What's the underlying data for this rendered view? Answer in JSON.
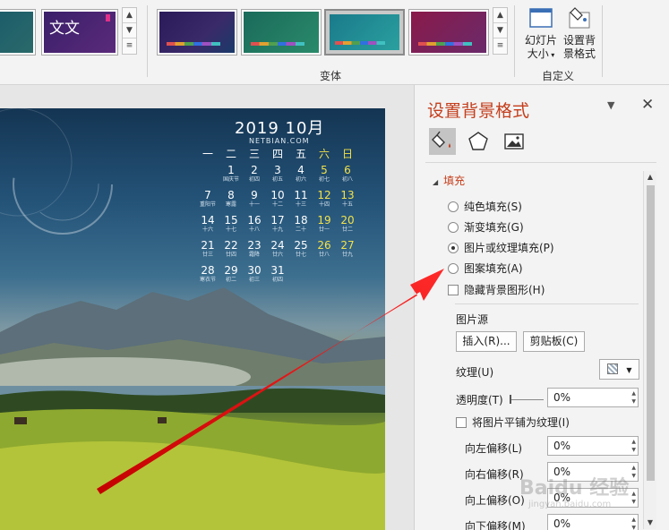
{
  "ribbon": {
    "variant_group_label": "变体",
    "custom_group_label": "自定义",
    "theme_thumb_text": "文文",
    "slide_size_label_1": "幻灯片",
    "slide_size_label_2": "大小",
    "format_bg_label_1": "设置背",
    "format_bg_label_2": "景格式",
    "colors": {
      "variant1": "#2a2a5a",
      "variant2": "#1f6a6a",
      "variant3": "#1c7a8a",
      "variant4": "#7a2a5a"
    }
  },
  "slide": {
    "calendar_title": "2019 10月",
    "calendar_site": "NETBIAN.COM",
    "weekdays": [
      "一",
      "二",
      "三",
      "四",
      "五",
      "六",
      "日"
    ],
    "weeks": [
      [
        [
          "",
          ""
        ],
        [
          "1",
          "国庆节"
        ],
        [
          "2",
          "初四"
        ],
        [
          "3",
          "初五"
        ],
        [
          "4",
          "初六"
        ],
        [
          "5",
          "初七"
        ],
        [
          "6",
          "初八"
        ]
      ],
      [
        [
          "7",
          "重阳节"
        ],
        [
          "8",
          "寒露"
        ],
        [
          "9",
          "十一"
        ],
        [
          "10",
          "十二"
        ],
        [
          "11",
          "十三"
        ],
        [
          "12",
          "十四"
        ],
        [
          "13",
          "十五"
        ]
      ],
      [
        [
          "14",
          "十六"
        ],
        [
          "15",
          "十七"
        ],
        [
          "16",
          "十八"
        ],
        [
          "17",
          "十九"
        ],
        [
          "18",
          "二十"
        ],
        [
          "19",
          "廿一"
        ],
        [
          "20",
          "廿二"
        ]
      ],
      [
        [
          "21",
          "廿三"
        ],
        [
          "22",
          "廿四"
        ],
        [
          "23",
          "霜降"
        ],
        [
          "24",
          "廿六"
        ],
        [
          "25",
          "廿七"
        ],
        [
          "26",
          "廿八"
        ],
        [
          "27",
          "廿九"
        ]
      ],
      [
        [
          "28",
          "寒衣节"
        ],
        [
          "29",
          "初二"
        ],
        [
          "30",
          "初三"
        ],
        [
          "31",
          "初四"
        ],
        [
          "",
          ""
        ],
        [
          "",
          ""
        ],
        [
          "",
          ""
        ]
      ]
    ]
  },
  "pane": {
    "title": "设置背景格式",
    "menu_glyph": "▼",
    "close_glyph": "✕",
    "section_fill": "填充",
    "fill_options": [
      {
        "label": "纯色填充(S)",
        "selected": false
      },
      {
        "label": "渐变填充(G)",
        "selected": false
      },
      {
        "label": "图片或纹理填充(P)",
        "selected": true
      },
      {
        "label": "图案填充(A)",
        "selected": false
      }
    ],
    "hide_bg_graphics": "隐藏背景图形(H)",
    "picture_source_label": "图片源",
    "insert_button": "插入(R)...",
    "clipboard_button": "剪贴板(C)",
    "texture_label": "纹理(U)",
    "transparency_label": "透明度(T)",
    "transparency_value": "0%",
    "tile_label": "将图片平铺为纹理(I)",
    "offset_left_label": "向左偏移(L)",
    "offset_left_value": "0%",
    "offset_right_label": "向右偏移(R)",
    "offset_right_value": "0%",
    "offset_top_label": "向上偏移(O)",
    "offset_top_value": "0%",
    "offset_bottom_label": "向下偏移(M)",
    "offset_bottom_value": "0%",
    "watermark": "Baidu 经验",
    "watermark_sub": "jingyan.baidu.com"
  }
}
